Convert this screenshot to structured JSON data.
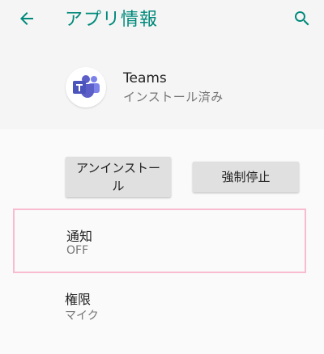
{
  "appbar": {
    "title": "アプリ情報",
    "accent_color": "#00897b",
    "back_icon": "arrow-back-icon",
    "search_icon": "search-icon"
  },
  "app": {
    "name": "Teams",
    "status": "インストール済み",
    "icon": "teams-app-icon",
    "icon_color": "#5b5fc7"
  },
  "actions": {
    "uninstall_label": "アンインストール",
    "force_stop_label": "強制停止"
  },
  "settings": {
    "notifications": {
      "title": "通知",
      "value": "OFF"
    },
    "permissions": {
      "title": "権限",
      "value": "マイク"
    }
  }
}
